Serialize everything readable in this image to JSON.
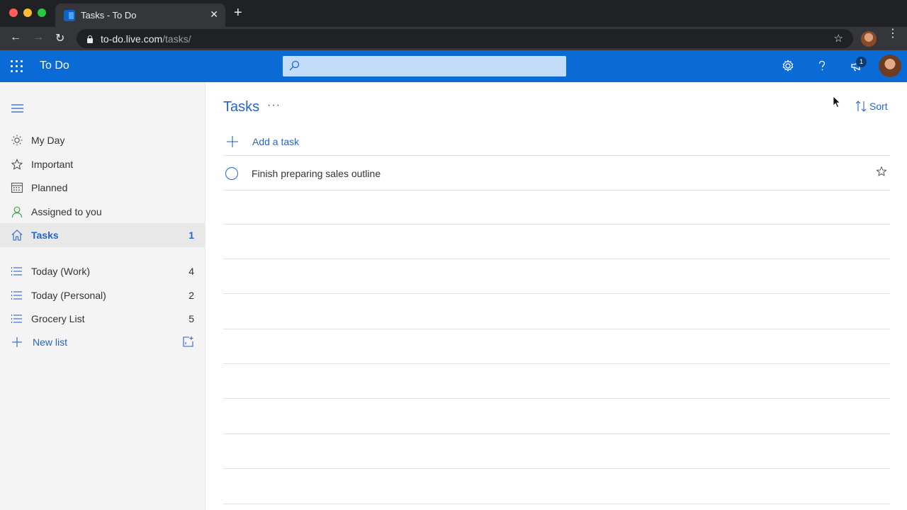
{
  "browser": {
    "tab_title": "Tasks - To Do",
    "url_host": "to-do.live.com",
    "url_path": "/tasks/",
    "new_tab": "+",
    "close_tab": "✕",
    "back": "←",
    "forward": "→",
    "reload": "↻",
    "bookmark": "☆",
    "menu": "⋮",
    "traffic_colors": [
      "#ff5f57",
      "#febc2e",
      "#28c840"
    ]
  },
  "appbar": {
    "title": "To Do",
    "search_placeholder": "",
    "notification_count": "1",
    "accent": "#0a6ad6"
  },
  "sidebar": {
    "items": [
      {
        "label": "My Day",
        "icon": "sun-icon",
        "count": ""
      },
      {
        "label": "Important",
        "icon": "star-icon",
        "count": ""
      },
      {
        "label": "Planned",
        "icon": "calendar-icon",
        "count": ""
      },
      {
        "label": "Assigned to you",
        "icon": "person-icon",
        "count": ""
      },
      {
        "label": "Tasks",
        "icon": "home-icon",
        "count": "1"
      }
    ],
    "lists": [
      {
        "label": "Today (Work)",
        "icon": "list-icon",
        "count": "4"
      },
      {
        "label": "Today (Personal)",
        "icon": "list-icon",
        "count": "2"
      },
      {
        "label": "Grocery List",
        "icon": "list-icon",
        "count": "5"
      }
    ],
    "new_list_label": "New list"
  },
  "main": {
    "title": "Tasks",
    "more": "···",
    "sort_label": "Sort",
    "add_task_label": "Add a task",
    "tasks": [
      {
        "title": "Finish preparing sales outline",
        "completed": false,
        "important": false
      }
    ]
  }
}
